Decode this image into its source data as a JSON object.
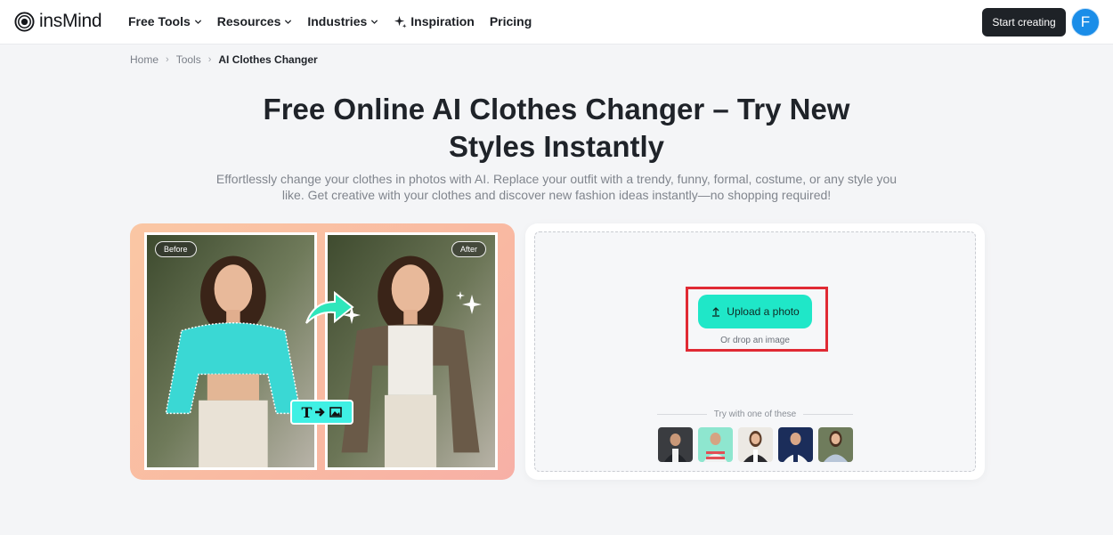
{
  "header": {
    "logo_text": "insMind",
    "nav": [
      {
        "label": "Free Tools",
        "icon": "chevron-down-icon"
      },
      {
        "label": "Resources",
        "icon": "chevron-down-icon"
      },
      {
        "label": "Industries",
        "icon": "chevron-down-icon"
      },
      {
        "label": "Inspiration",
        "icon": "sparkle-icon"
      },
      {
        "label": "Pricing"
      }
    ],
    "cta_label": "Start creating",
    "avatar_initial": "F"
  },
  "breadcrumb": {
    "items": [
      "Home",
      "Tools"
    ],
    "current": "AI Clothes Changer"
  },
  "hero": {
    "title_line1": "Free Online AI Clothes Changer – Try New",
    "title_line2": "Styles Instantly",
    "subtitle_line1": "Effortlessly change your clothes in photos with AI. Replace your outfit with a trendy, funny, formal, costume, or any style you",
    "subtitle_line2": "like. Get creative with your clothes and discover new fashion ideas instantly—no shopping required!"
  },
  "showcase": {
    "before_label": "Before",
    "after_label": "After",
    "badge_letter": "T"
  },
  "upload": {
    "button_label": "Upload a photo",
    "drop_text": "Or drop an image",
    "try_label": "Try with one of these",
    "samples": [
      "sample-1",
      "sample-2",
      "sample-3",
      "sample-4",
      "sample-5"
    ]
  },
  "colors": {
    "accent": "#1fe7c8",
    "highlight": "#e02a34",
    "dark_button": "#1e2227",
    "avatar": "#1a8de8"
  }
}
